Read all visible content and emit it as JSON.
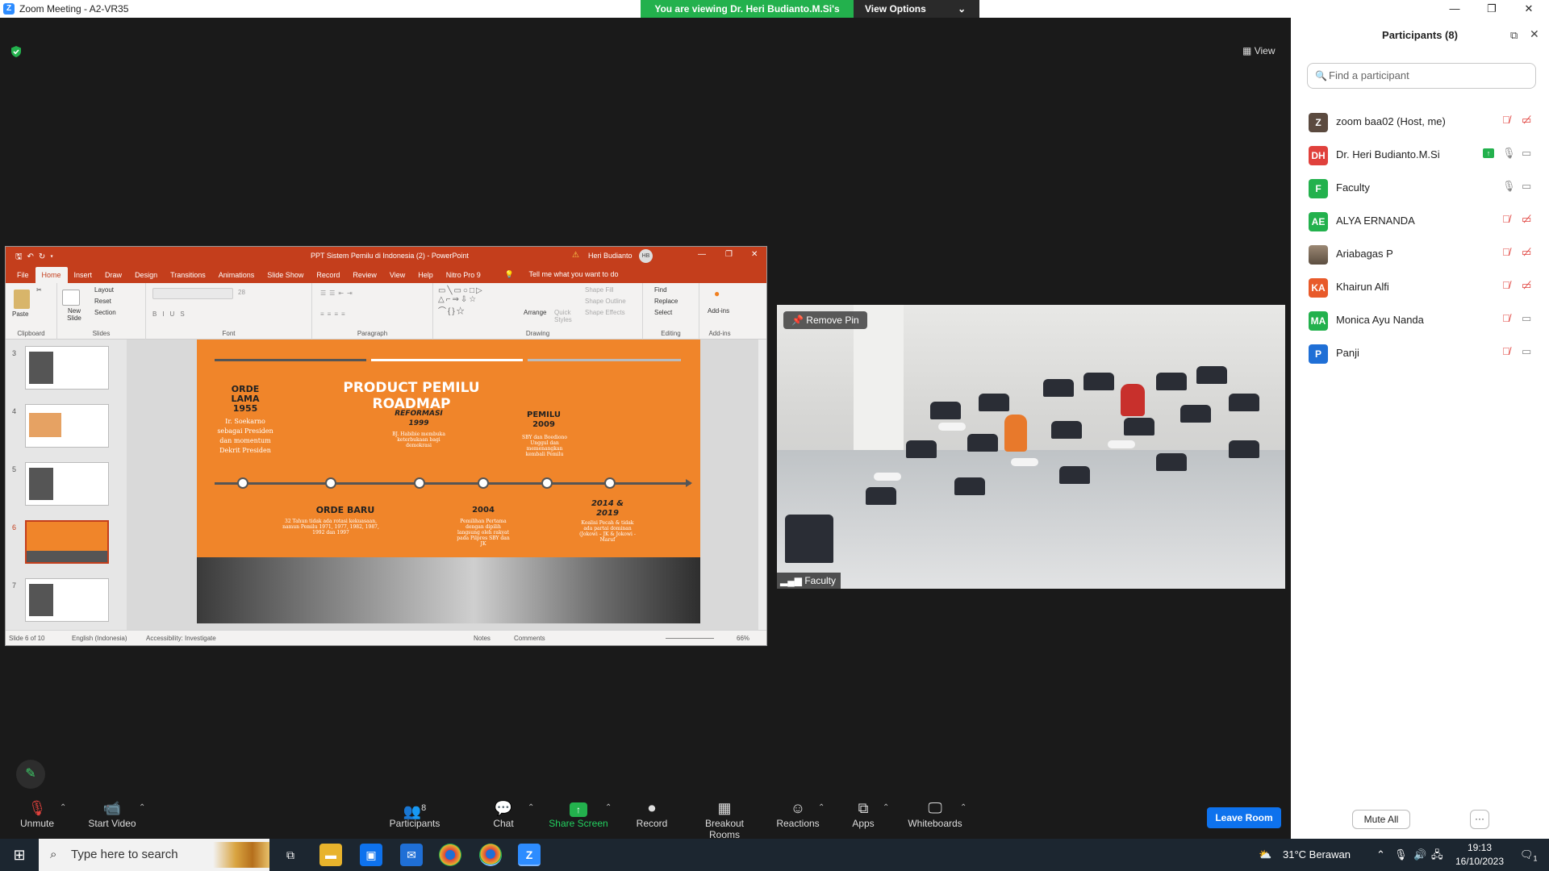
{
  "window": {
    "title": "Zoom Meeting - A2-VR35",
    "minimize": "—",
    "restore": "❐",
    "close": "✕"
  },
  "banner": {
    "viewing_text": "You are viewing Dr. Heri Budianto.M.Si's screen",
    "view_options": "View Options",
    "chevron": "⌄"
  },
  "stage": {
    "view_label": "View"
  },
  "ppt": {
    "title": "PPT Sistem Pemilu di Indonesia (2)  -  PowerPoint",
    "user": "Heri Budianto",
    "user_initials": "HB",
    "tabs": [
      "File",
      "Home",
      "Insert",
      "Draw",
      "Design",
      "Transitions",
      "Animations",
      "Slide Show",
      "Record",
      "Review",
      "View",
      "Help",
      "Nitro Pro 9"
    ],
    "tell_me": "Tell me what you want to do",
    "ribbon": {
      "paste": "Paste",
      "clipboard": "Clipboard",
      "layout": "Layout",
      "reset": "Reset",
      "new_slide": "New Slide",
      "section": "Section",
      "slides": "Slides",
      "font": "Font",
      "font_size": "28",
      "paragraph": "Paragraph",
      "drawing": "Drawing",
      "arrange": "Arrange",
      "quick_styles": "Quick Styles",
      "shape_fill": "Shape Fill",
      "shape_outline": "Shape Outline",
      "shape_effects": "Shape Effects",
      "find": "Find",
      "replace": "Replace",
      "select": "Select",
      "editing": "Editing",
      "addins": "Add-ins",
      "addins_group": "Add-ins"
    },
    "thumbnails": [
      "3",
      "4",
      "5",
      "6",
      "7"
    ],
    "status": {
      "slide": "Slide 6 of 10",
      "language": "English (Indonesia)",
      "accessibility": "Accessibility: Investigate",
      "notes": "Notes",
      "comments": "Comments",
      "zoom": "66%"
    },
    "slide": {
      "title": "PRODUCT PEMILU ROADMAP",
      "orde_lama": "ORDE LAMA 1955",
      "orde_lama_text": "Ir. Soekarno sebagai Presiden dan momentum Dekrit Presiden",
      "reformasi": "REFORMASI 1999",
      "reformasi_text": "BJ. Habibie membuka keterbukaan bagi demokrasi",
      "pemilu2009": "PEMILU 2009",
      "pemilu2009_text": "SBY dan Boediono Unggul dan memenangkan kembali Pemilu",
      "orde_baru": "ORDE BARU",
      "orde_baru_text": "32 Tahun tidak ada rotasi kekuasaan, namun Pemilu 1971, 1977, 1982, 1987, 1992 dan 1997",
      "y2004": "2004",
      "y2004_text": "Pemilihan Pertama dengan dipilih langsung oleh rakyat pada Pilpres SBY dan JK",
      "y2014": "2014 & 2019",
      "y2014_text": "Koalisi Pecah & tidak ada partai dominan (Jokowi – JK & Jokowi - Maruf"
    }
  },
  "video": {
    "remove_pin": "Remove Pin",
    "label": "Faculty"
  },
  "toolbar": {
    "unmute": "Unmute",
    "start_video": "Start Video",
    "participants": "Participants",
    "participants_count": "8",
    "chat": "Chat",
    "share_screen": "Share Screen",
    "record": "Record",
    "breakout": "Breakout Rooms",
    "reactions": "Reactions",
    "apps": "Apps",
    "whiteboards": "Whiteboards",
    "leave": "Leave Room",
    "caret": "⌃"
  },
  "participants_panel": {
    "title": "Participants (8)",
    "search_placeholder": "Find a participant",
    "mute_all": "Mute All",
    "more": "···",
    "people": [
      {
        "initials": "Z",
        "name": "zoom baa02 (Host, me)",
        "color": "#5b4a3f",
        "mic": "muted",
        "cam": "off"
      },
      {
        "initials": "DH",
        "name": "Dr. Heri Budianto.M.Si",
        "color": "#e0413c",
        "mic": "on",
        "cam": "on",
        "sharing": true
      },
      {
        "initials": "F",
        "name": "Faculty",
        "color": "#23b14d",
        "mic": "on",
        "cam": "on"
      },
      {
        "initials": "AE",
        "name": "ALYA ERNANDA",
        "color": "#23b14d",
        "mic": "muted",
        "cam": "off"
      },
      {
        "initials": "",
        "name": "Ariabagas P",
        "color": "#7a6a58",
        "mic": "muted",
        "cam": "off"
      },
      {
        "initials": "KA",
        "name": "Khairun Alfi",
        "color": "#e85a2a",
        "mic": "muted",
        "cam": "off"
      },
      {
        "initials": "MA",
        "name": "Monica Ayu Nanda",
        "color": "#23b14d",
        "mic": "muted",
        "cam": "on"
      },
      {
        "initials": "P",
        "name": "Panji",
        "color": "#1f6fd6",
        "mic": "muted",
        "cam": "on"
      }
    ]
  },
  "taskbar": {
    "search_placeholder": "Type here to search",
    "weather": "31°C  Berawan",
    "time": "19:13",
    "date": "16/10/2023",
    "notif": "1"
  }
}
